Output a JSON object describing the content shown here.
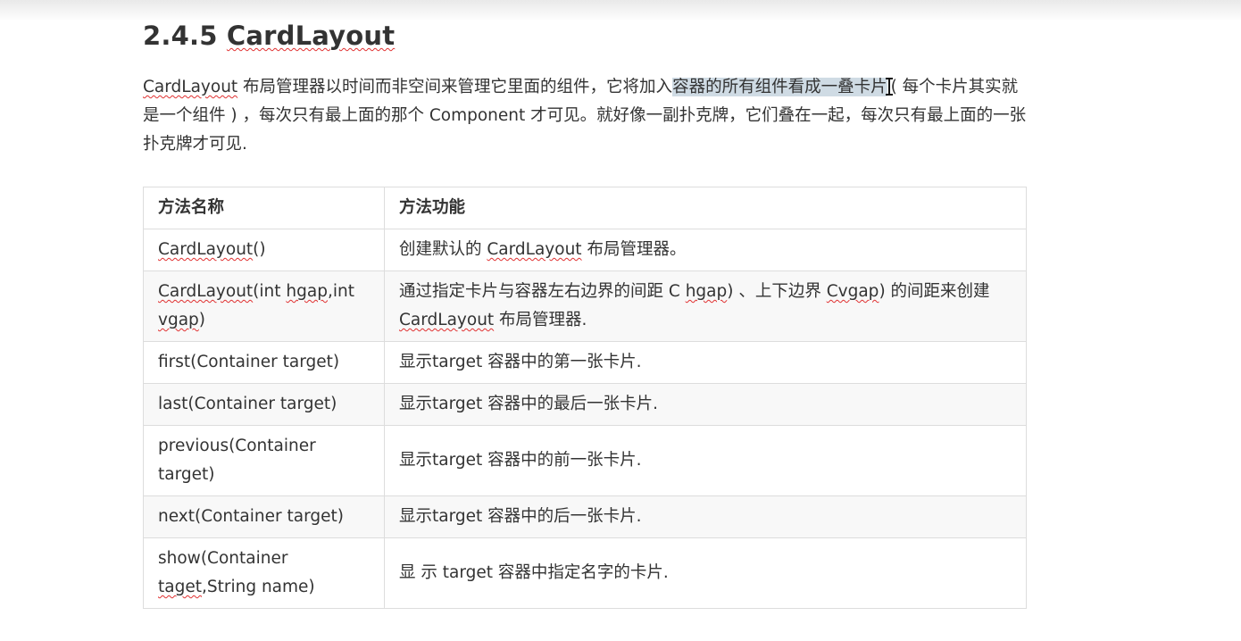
{
  "heading": {
    "number": "2.4.5",
    "title": "CardLayout"
  },
  "intro": {
    "term": "CardLayout",
    "text_a": " 布局管理器以时间而非空间来管理它里面的组件，它将加入",
    "text_selected": "容器的所有组件看成一叠卡片",
    "text_b": "( 每个卡片其实就是一个组件 ) ，每次只有最上面的那个 Component 才可见。就好像一副扑克牌，它们叠在一起，每次只有最上面的一张扑克牌才可见."
  },
  "table": {
    "headers": [
      "方法名称",
      "方法功能"
    ],
    "rows": [
      {
        "method": [
          {
            "t": "CardLayout",
            "w": true
          },
          {
            "t": "()"
          }
        ],
        "desc": [
          {
            "t": "创建默认的 "
          },
          {
            "t": "CardLayout",
            "w": true
          },
          {
            "t": " 布局管理器。"
          }
        ]
      },
      {
        "method": [
          {
            "t": "CardLayout",
            "w": true
          },
          {
            "t": "(int "
          },
          {
            "t": "hgap",
            "w": true
          },
          {
            "t": ",int "
          },
          {
            "t": "vgap",
            "w": true
          },
          {
            "t": ")"
          }
        ],
        "desc": [
          {
            "t": "通过指定卡片与容器左右边界的间距 C "
          },
          {
            "t": "hgap",
            "w": true
          },
          {
            "t": ") 、上下边界 "
          },
          {
            "t": "Cvgap",
            "w": true
          },
          {
            "t": ") 的间距来创建 "
          },
          {
            "t": "CardLayout",
            "w": true
          },
          {
            "t": " 布局管理器."
          }
        ]
      },
      {
        "method": [
          {
            "t": "first(Container target)"
          }
        ],
        "desc": [
          {
            "t": "显示target 容器中的第一张卡片."
          }
        ]
      },
      {
        "method": [
          {
            "t": "last(Container target)"
          }
        ],
        "desc": [
          {
            "t": "显示target 容器中的最后一张卡片."
          }
        ]
      },
      {
        "method": [
          {
            "t": "previous(Container target)"
          }
        ],
        "desc": [
          {
            "t": "显示target 容器中的前一张卡片."
          }
        ]
      },
      {
        "method": [
          {
            "t": "next(Container target)"
          }
        ],
        "desc": [
          {
            "t": "显示target 容器中的后一张卡片."
          }
        ]
      },
      {
        "method": [
          {
            "t": "show(Container "
          },
          {
            "t": "taget",
            "w": true
          },
          {
            "t": ",String name)"
          }
        ],
        "desc": [
          {
            "t": "显 示 target 容器中指定名字的卡片."
          }
        ]
      }
    ]
  },
  "colors": {
    "text": "#333333",
    "border": "#dddddd",
    "selection": "#cfdbe4",
    "spellcheck": "#e03030"
  }
}
